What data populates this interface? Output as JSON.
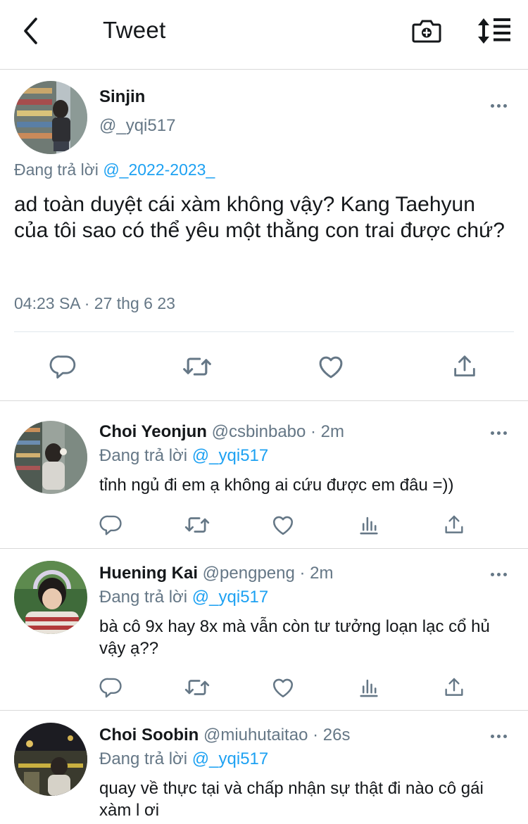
{
  "header": {
    "title": "Tweet",
    "back_icon": "chevron-left-icon",
    "camera_icon": "camera-plus-icon",
    "sort_icon": "sort-icon"
  },
  "main_tweet": {
    "name": "Sinjin",
    "handle": "@_yqi517",
    "reply_prefix": "Đang trả lời",
    "reply_to": "@_2022-2023_",
    "text": "ad toàn duyệt cái xàm không vậy? Kang Taehyun của tôi sao có thể yêu một thằng con trai được chứ?",
    "timestamp": "04:23 SA · 27 thg 6 23",
    "actions": [
      "reply-icon",
      "retweet-icon",
      "like-icon",
      "share-icon"
    ]
  },
  "replies": [
    {
      "name": "Choi Yeonjun",
      "meta": " @csbinbabo · 2m",
      "reply_prefix": "Đang trả lời",
      "reply_to": "@_yqi517",
      "text": "tỉnh ngủ đi em ạ không ai cứu được em đâu =))"
    },
    {
      "name": "Huening Kai",
      "meta": " @pengpeng · 2m",
      "reply_prefix": "Đang trả lời",
      "reply_to": "@_yqi517",
      "text": "bà cô 9x hay 8x mà vẫn còn tư tưởng loạn lạc cổ hủ vậy ạ??"
    },
    {
      "name": "Choi Soobin",
      "meta": " @miuhutaitao · 26s",
      "reply_prefix": "Đang trả lời",
      "reply_to": "@_yqi517",
      "text": "quay về thực tại và chấp nhận sự thật đi nào cô gái xàm l ơi"
    }
  ],
  "reply_actions": [
    "reply-icon",
    "retweet-icon",
    "like-icon",
    "analytics-icon",
    "share-icon"
  ],
  "colors": {
    "text": "#14171a",
    "secondary": "#657786",
    "link": "#1da1f2",
    "divider": "#d9d9d9"
  }
}
